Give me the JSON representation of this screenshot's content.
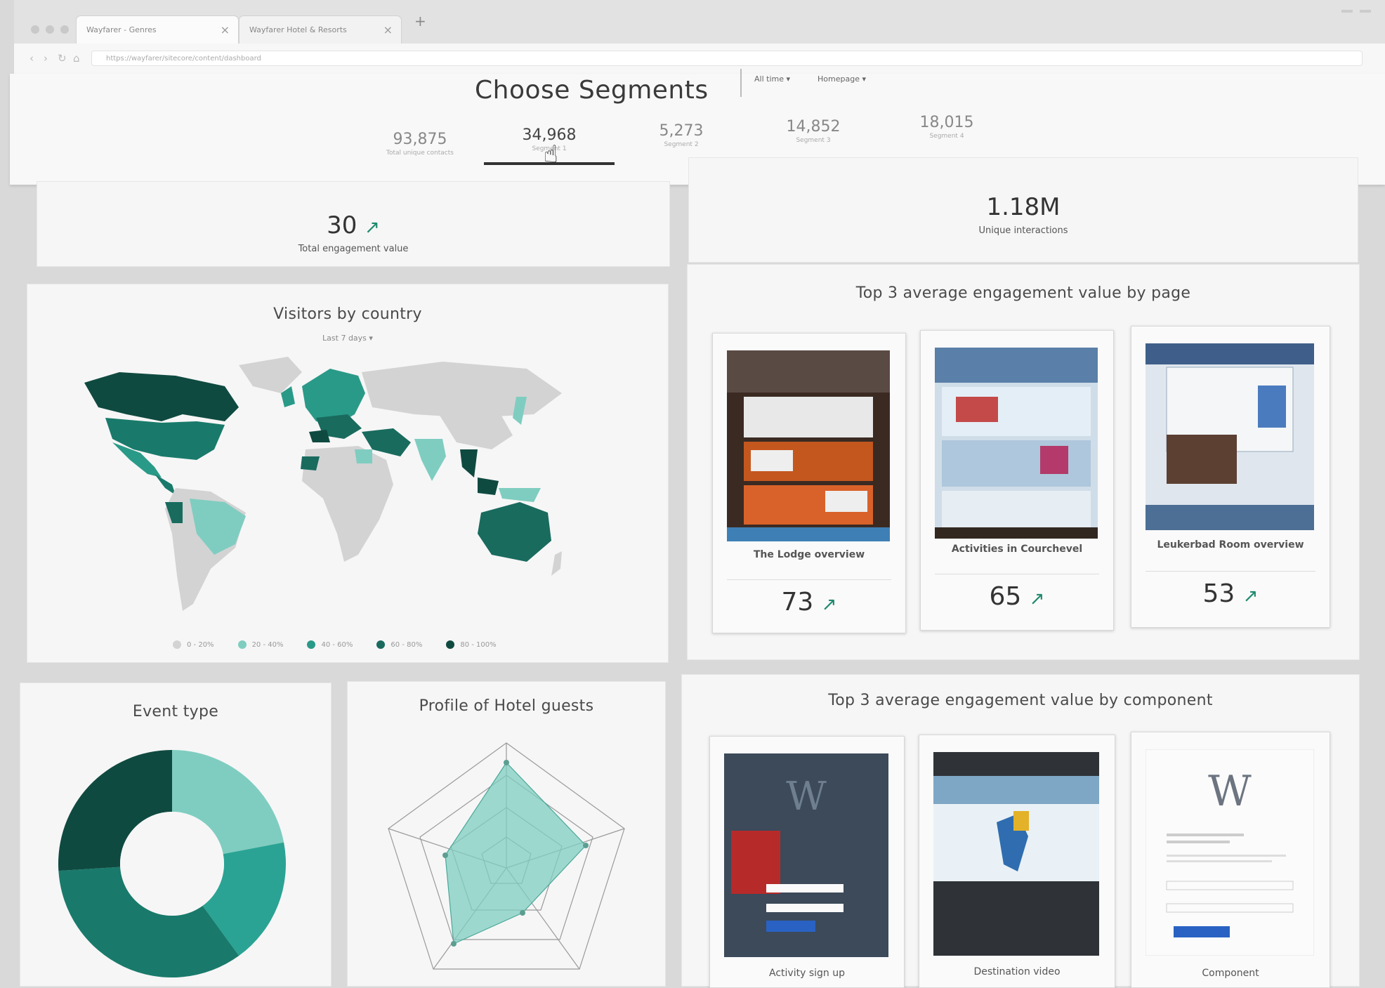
{
  "browser": {
    "tabs": [
      {
        "label": "Wayfarer - Genres",
        "active": true
      },
      {
        "label": "Wayfarer Hotel & Resorts",
        "active": false
      }
    ],
    "url": "https://wayfarer/sitecore/content/dashboard"
  },
  "header": {
    "title": "Choose Segments",
    "filter_time": "All time",
    "filter_page": "Homepage",
    "segments": [
      {
        "value": "93,875",
        "label": "Total unique contacts",
        "active": false
      },
      {
        "value": "34,968",
        "label": "Segment 1",
        "active": true
      },
      {
        "value": "5,273",
        "label": "Segment 2",
        "active": false
      },
      {
        "value": "14,852",
        "label": "Segment 3",
        "active": false
      },
      {
        "value": "18,015",
        "label": "Segment 4",
        "active": false
      }
    ]
  },
  "kpis": {
    "engagement": {
      "value": "30",
      "label": "Total engagement value",
      "trend": "up"
    },
    "interactions": {
      "value": "1.18M",
      "label": "Unique interactions"
    }
  },
  "visitors_map": {
    "title": "Visitors by country",
    "range": "Last 7 days",
    "legend": [
      {
        "label": "0 - 20%",
        "color": "#d3d3d3"
      },
      {
        "label": "20 - 40%",
        "color": "#7fcdc0"
      },
      {
        "label": "40 - 60%",
        "color": "#2a9a88"
      },
      {
        "label": "60 - 80%",
        "color": "#196b5e"
      },
      {
        "label": "80 - 100%",
        "color": "#0f4a40"
      }
    ]
  },
  "top_pages": {
    "title": "Top 3 average engagement value by page",
    "items": [
      {
        "name": "The Lodge overview",
        "value": "73"
      },
      {
        "name": "Activities in Courchevel",
        "value": "65"
      },
      {
        "name": "Leukerbad Room overview",
        "value": "53"
      }
    ]
  },
  "event_type": {
    "title": "Event type",
    "chart_data": {
      "type": "pie",
      "values": [
        22,
        18,
        34,
        26
      ],
      "colors": [
        "#7fcdc0",
        "#2aa394",
        "#197a6b",
        "#0f4a40"
      ]
    }
  },
  "hotel_profile": {
    "title": "Profile of Hotel guests"
  },
  "top_components": {
    "title": "Top 3 average engagement value by component",
    "items": [
      {
        "name": "Activity sign up"
      },
      {
        "name": "Destination video"
      },
      {
        "name": "Component"
      }
    ]
  }
}
